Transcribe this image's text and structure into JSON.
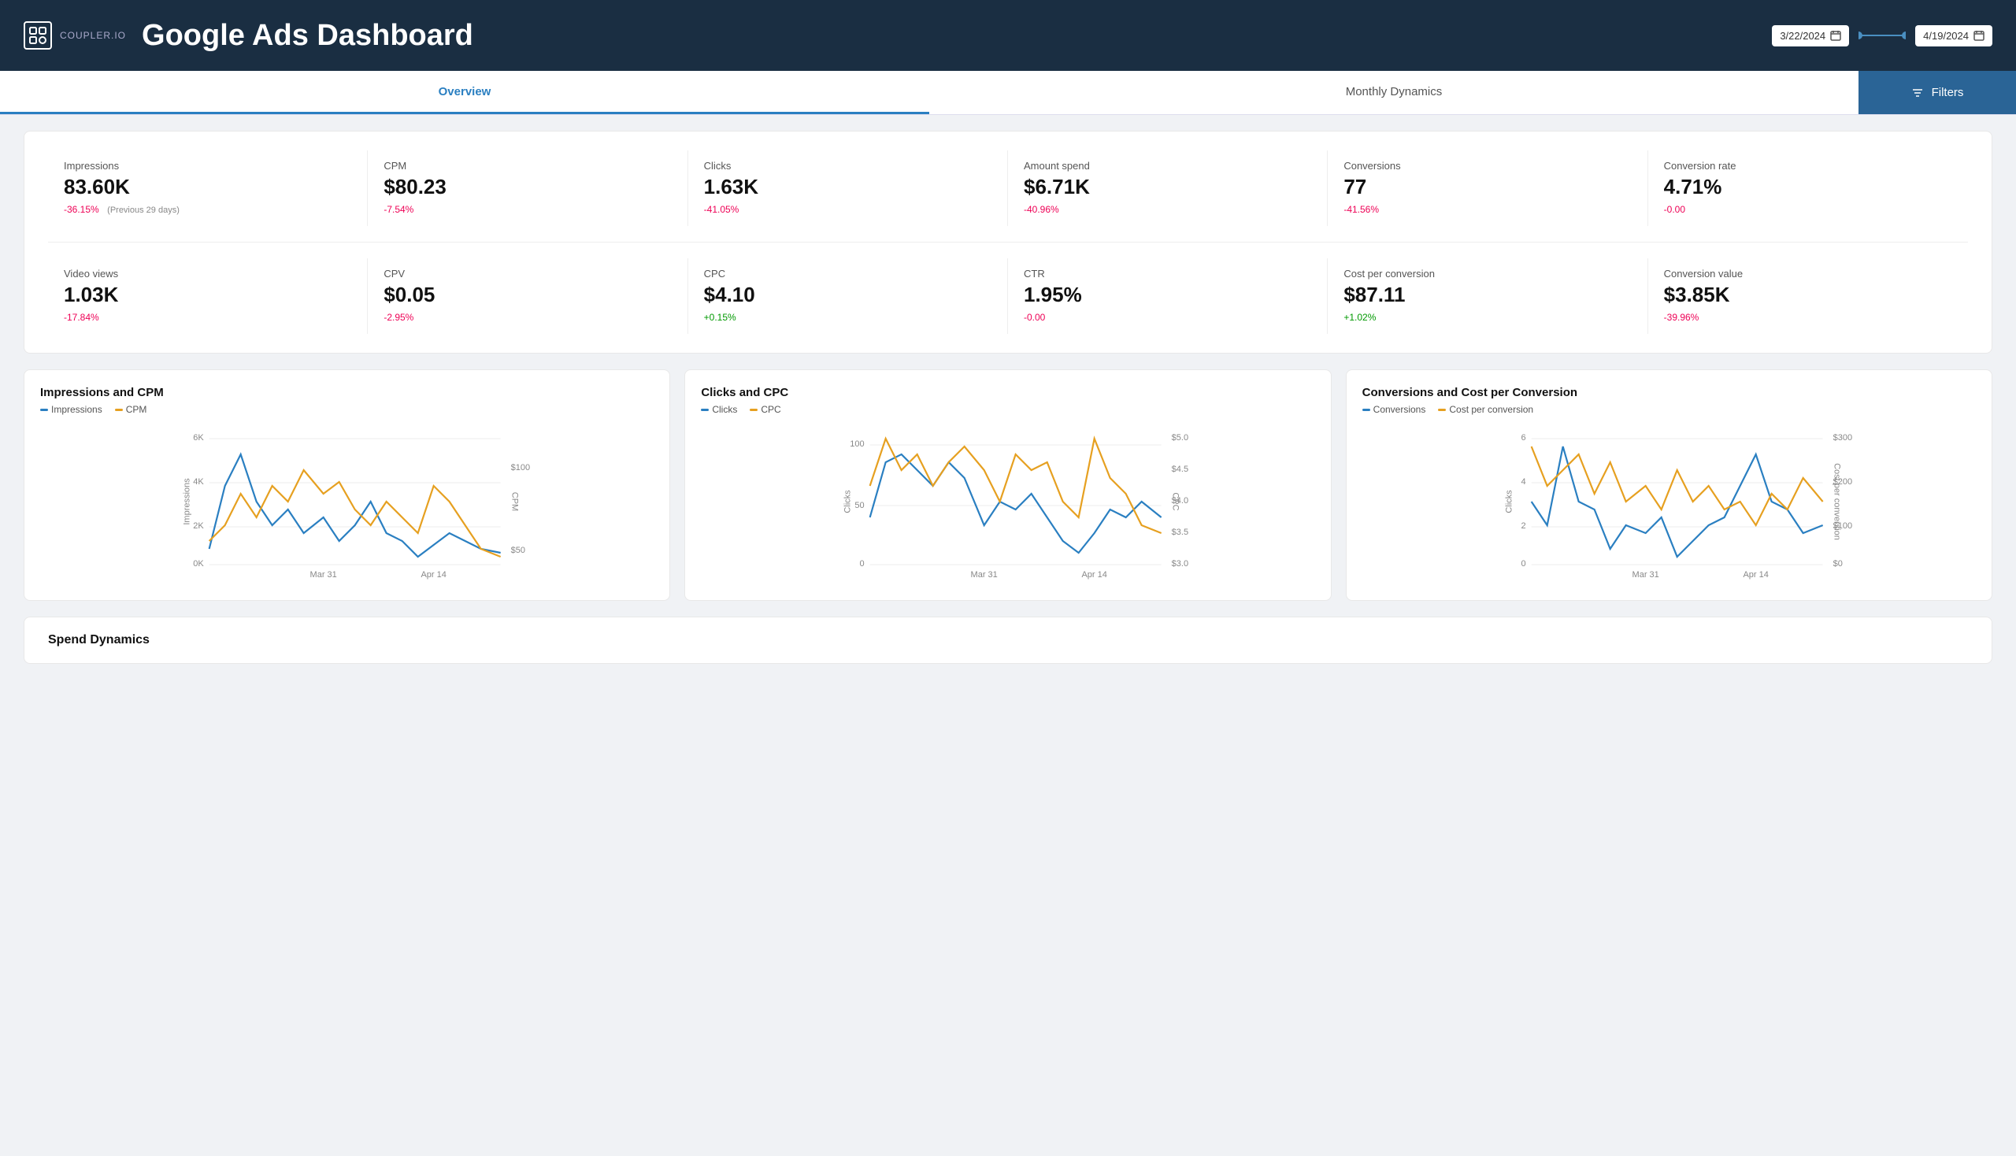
{
  "header": {
    "logo_text": "COUPLER.IO",
    "title": "Google Ads Dashboard",
    "date_from": "3/22/2024",
    "date_to": "4/19/2024"
  },
  "nav": {
    "tabs": [
      {
        "id": "overview",
        "label": "Overview",
        "active": true
      },
      {
        "id": "monthly-dynamics",
        "label": "Monthly Dynamics",
        "active": false
      }
    ],
    "filters_label": "Filters"
  },
  "metrics": {
    "row1": [
      {
        "id": "impressions",
        "label": "Impressions",
        "value": "83.60K",
        "change": "-36.15%",
        "change_type": "negative",
        "prev": "(Previous 29 days)"
      },
      {
        "id": "cpm",
        "label": "CPM",
        "value": "$80.23",
        "change": "-7.54%",
        "change_type": "negative",
        "prev": ""
      },
      {
        "id": "clicks",
        "label": "Clicks",
        "value": "1.63K",
        "change": "-41.05%",
        "change_type": "negative",
        "prev": ""
      },
      {
        "id": "amount-spend",
        "label": "Amount spend",
        "value": "$6.71K",
        "change": "-40.96%",
        "change_type": "negative",
        "prev": ""
      },
      {
        "id": "conversions",
        "label": "Conversions",
        "value": "77",
        "change": "-41.56%",
        "change_type": "negative",
        "prev": ""
      },
      {
        "id": "conversion-rate",
        "label": "Conversion rate",
        "value": "4.71%",
        "change": "-0.00",
        "change_type": "negative",
        "prev": ""
      }
    ],
    "row2": [
      {
        "id": "video-views",
        "label": "Video views",
        "value": "1.03K",
        "change": "-17.84%",
        "change_type": "negative",
        "prev": ""
      },
      {
        "id": "cpv",
        "label": "CPV",
        "value": "$0.05",
        "change": "-2.95%",
        "change_type": "negative",
        "prev": ""
      },
      {
        "id": "cpc",
        "label": "CPC",
        "value": "$4.10",
        "change": "+0.15%",
        "change_type": "positive",
        "prev": ""
      },
      {
        "id": "ctr",
        "label": "CTR",
        "value": "1.95%",
        "change": "-0.00",
        "change_type": "negative",
        "prev": ""
      },
      {
        "id": "cost-per-conversion",
        "label": "Cost per conversion",
        "value": "$87.11",
        "change": "+1.02%",
        "change_type": "positive",
        "prev": ""
      },
      {
        "id": "conversion-value",
        "label": "Conversion value",
        "value": "$3.85K",
        "change": "-39.96%",
        "change_type": "negative",
        "prev": ""
      }
    ]
  },
  "charts": [
    {
      "id": "impressions-cpm",
      "title": "Impressions and CPM",
      "legend": [
        {
          "label": "Impressions",
          "color": "#2a7fc1"
        },
        {
          "label": "CPM",
          "color": "#e6a020"
        }
      ],
      "y_left_label": "Impressions",
      "y_right_label": "CPM",
      "y_left_ticks": [
        "6K",
        "4K",
        "2K",
        "0K"
      ],
      "y_right_ticks": [
        "$100",
        "$50"
      ],
      "x_ticks": [
        "Mar 31",
        "Apr 14"
      ]
    },
    {
      "id": "clicks-cpc",
      "title": "Clicks and CPC",
      "legend": [
        {
          "label": "Clicks",
          "color": "#2a7fc1"
        },
        {
          "label": "CPC",
          "color": "#e6a020"
        }
      ],
      "y_left_label": "Clicks",
      "y_right_label": "CPC",
      "y_left_ticks": [
        "100",
        "50",
        "0"
      ],
      "y_right_ticks": [
        "$5.0",
        "$4.5",
        "$4.0",
        "$3.5",
        "$3.0"
      ],
      "x_ticks": [
        "Mar 31",
        "Apr 14"
      ]
    },
    {
      "id": "conversions-cost",
      "title": "Conversions and Cost per Conversion",
      "legend": [
        {
          "label": "Conversions",
          "color": "#2a7fc1"
        },
        {
          "label": "Cost per conversion",
          "color": "#e6a020"
        }
      ],
      "y_left_label": "Clicks",
      "y_right_label": "Cost per conversion",
      "y_left_ticks": [
        "6",
        "4",
        "2",
        "0"
      ],
      "y_right_ticks": [
        "$300",
        "$200",
        "$100",
        "$0"
      ],
      "x_ticks": [
        "Mar 31",
        "Apr 14"
      ]
    }
  ],
  "spend_dynamics": {
    "title": "Spend Dynamics"
  },
  "colors": {
    "blue_line": "#2a7fc1",
    "orange_line": "#e6a020",
    "header_bg": "#1a2e42",
    "filters_bg": "#2a6496",
    "active_tab": "#2a7fc1"
  }
}
